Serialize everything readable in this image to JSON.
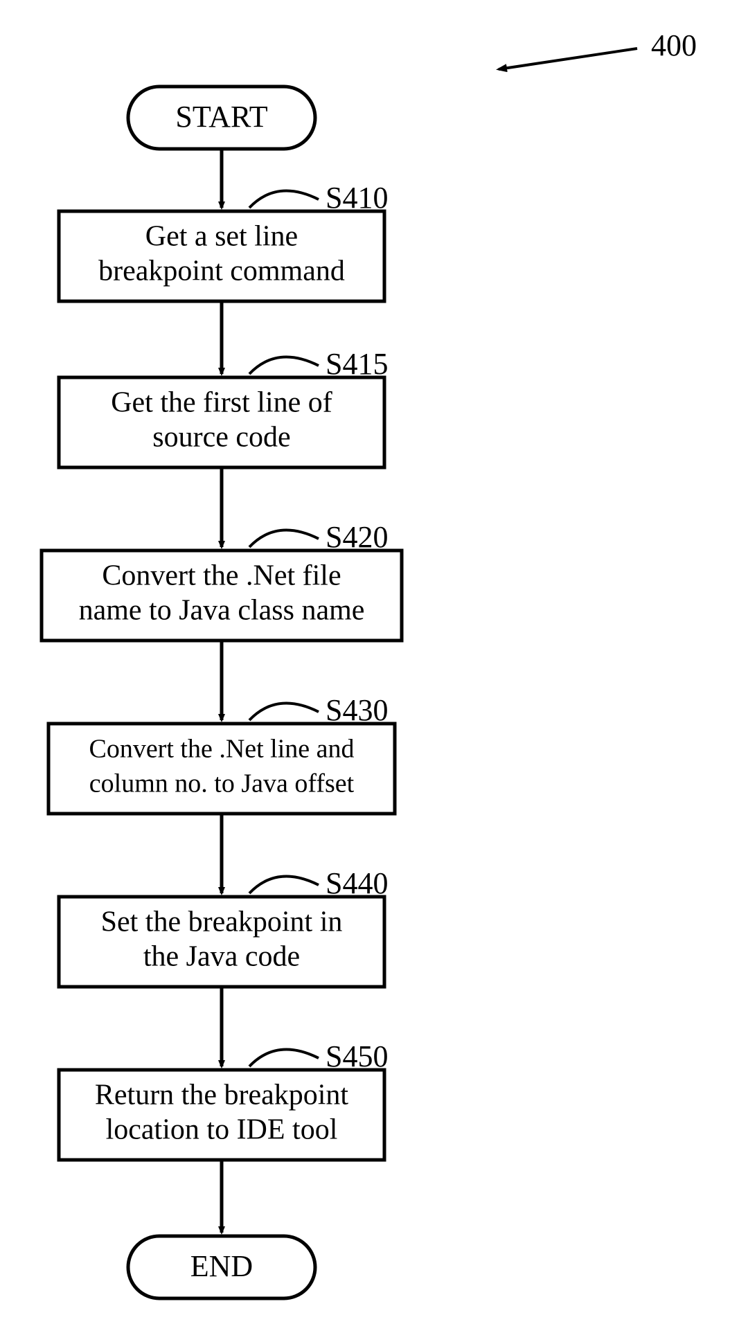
{
  "figure_ref": "400",
  "terminals": {
    "start": "START",
    "end": "END"
  },
  "steps": [
    {
      "id": "S410",
      "line1": "Get a set line",
      "line2": "breakpoint command"
    },
    {
      "id": "S415",
      "line1": "Get the first line of",
      "line2": "source code"
    },
    {
      "id": "S420",
      "line1": "Convert the .Net file",
      "line2": "name to Java class name"
    },
    {
      "id": "S430",
      "line1": "Convert the .Net line and",
      "line2": "column no. to Java offset"
    },
    {
      "id": "S440",
      "line1": "Set the breakpoint in",
      "line2": "the Java code"
    },
    {
      "id": "S450",
      "line1": "Return the breakpoint",
      "line2": "location to IDE tool"
    }
  ]
}
